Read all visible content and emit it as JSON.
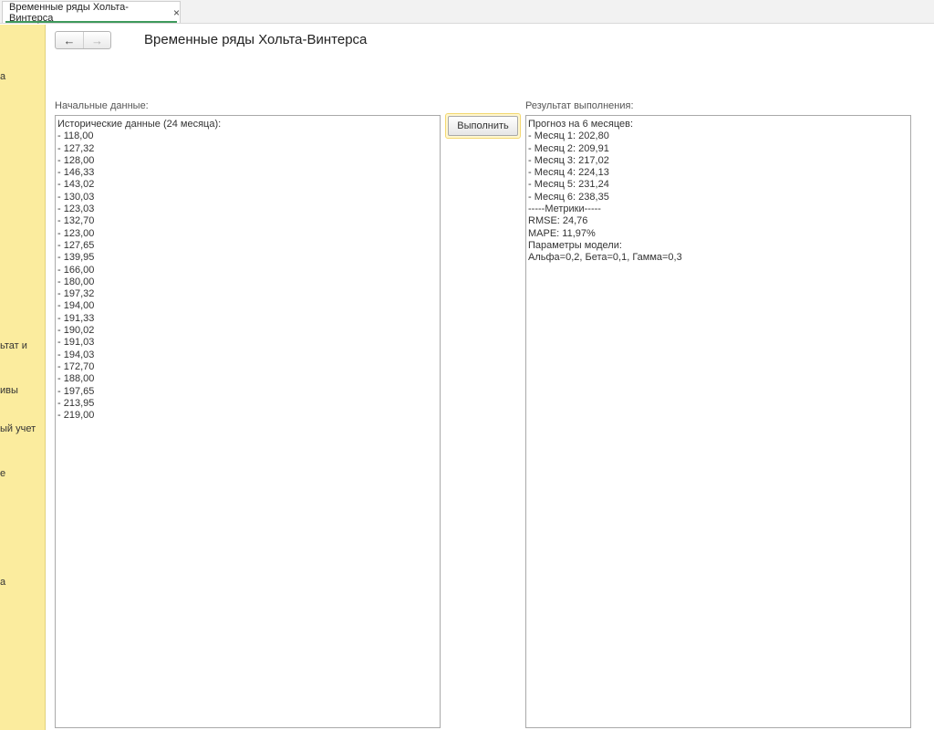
{
  "tab": {
    "title": "Временные ряды Хольта-Винтерса",
    "close_glyph": "×"
  },
  "sidebar": {
    "items": [
      {
        "label": "а"
      },
      {
        "label": "ьтат и"
      },
      {
        "label": "ивы"
      },
      {
        "label": "ый учет"
      },
      {
        "label": "е"
      },
      {
        "label": "а"
      }
    ]
  },
  "nav": {
    "back_icon": "←",
    "forward_icon": "→"
  },
  "page": {
    "title": "Временные ряды Хольта-Винтерса"
  },
  "input": {
    "label": "Начальные данные:",
    "lines": [
      "Исторические данные (24 месяца):",
      "- 118,00",
      "- 127,32",
      "- 128,00",
      "- 146,33",
      "- 143,02",
      "- 130,03",
      "- 123,03",
      "- 132,70",
      "- 123,00",
      "- 127,65",
      "- 139,95",
      "- 166,00",
      "- 180,00",
      "- 197,32",
      "- 194,00",
      "- 191,33",
      "- 190,02",
      "- 191,03",
      "- 194,03",
      "- 172,70",
      "- 188,00",
      "- 197,65",
      "- 213,95",
      "- 219,00"
    ]
  },
  "run_button": {
    "label": "Выполнить"
  },
  "result": {
    "label": "Результат выполнения:",
    "lines": [
      "Прогноз на 6 месяцев:",
      "- Месяц 1: 202,80",
      "- Месяц 2: 209,91",
      "- Месяц 3: 217,02",
      "- Месяц 4: 224,13",
      "- Месяц 5: 231,24",
      "- Месяц 6: 238,35",
      "-----Метрики-----",
      "RMSE: 24,76",
      "MAPE: 11,97%",
      "Параметры модели:",
      "Альфа=0,2, Бета=0,1, Гамма=0,3"
    ]
  },
  "colors": {
    "sidebar_bg": "#fbec9e",
    "tab_accent": "#3e9a5c",
    "button_highlight": "#fff7cf"
  }
}
